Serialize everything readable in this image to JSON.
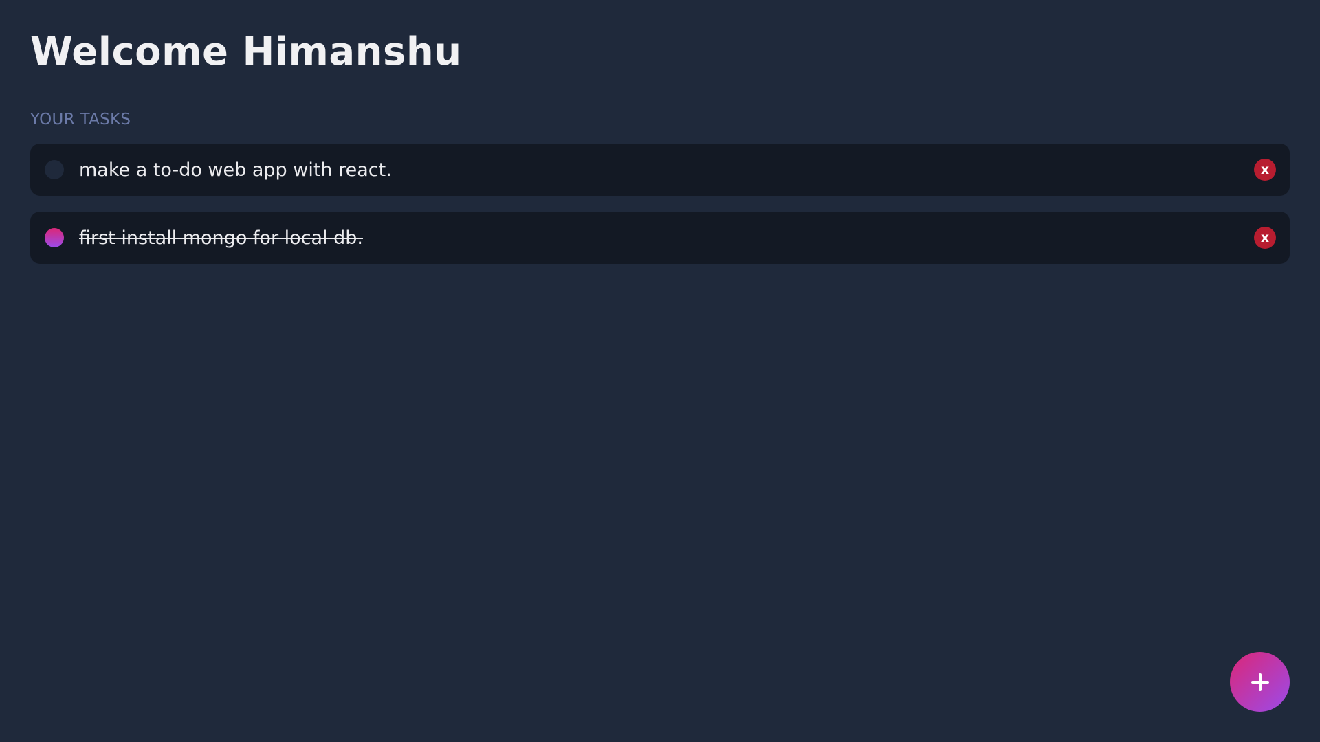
{
  "header": {
    "title": "Welcome Himanshu"
  },
  "tasks_section": {
    "label": "YOUR TASKS",
    "items": [
      {
        "text": "make a to-do web app with react.",
        "completed": false,
        "delete_label": "x"
      },
      {
        "text": "first install mongo for local db.",
        "completed": true,
        "delete_label": "x"
      }
    ]
  },
  "fab": {
    "icon": "plus-icon"
  },
  "colors": {
    "background": "#1f293b",
    "card": "#131924",
    "label": "#6b7aa8",
    "delete": "#b81d30",
    "accent_start": "#db2777",
    "accent_end": "#9b4bea"
  }
}
